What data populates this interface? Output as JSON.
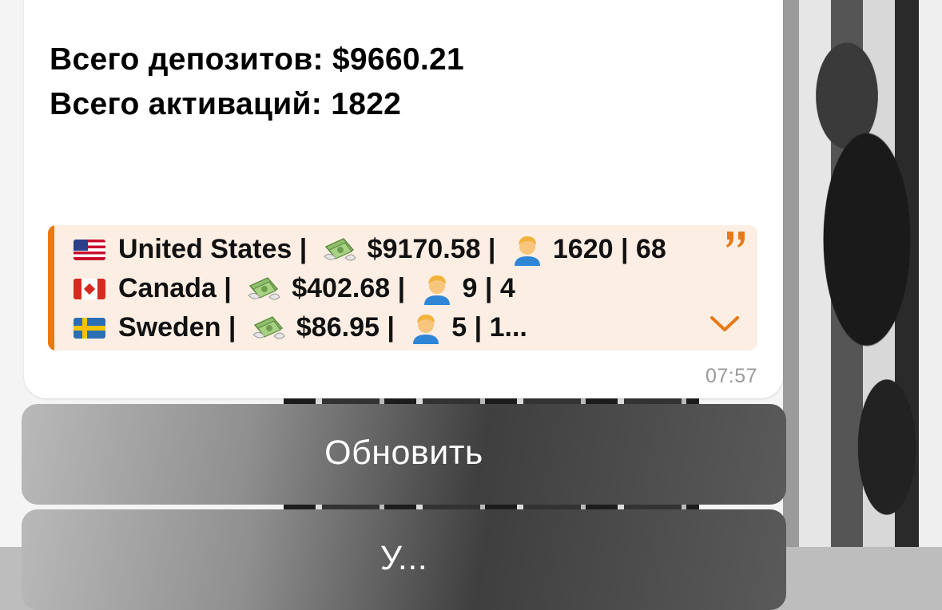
{
  "message": {
    "total_deposits": "Всего депозитов: $9660.21",
    "total_activations": "Всего активаций: 1822",
    "time": "07:57",
    "quote": {
      "rows": [
        {
          "flag": "flag-us",
          "country": "United States",
          "sep1": " | ",
          "amount": "$9170.58",
          "sep2": " | ",
          "stats": "1620 | 68"
        },
        {
          "flag": "flag-ca",
          "country": "Canada",
          "sep1": " | ",
          "amount": "$402.68",
          "sep2": " | ",
          "stats": "9 | 4"
        },
        {
          "flag": "flag-se",
          "country": "Sweden",
          "sep1": " | ",
          "amount": "$86.95",
          "sep2": " | ",
          "stats": "5 | 1..."
        }
      ],
      "accent_color": "#e67a16",
      "background_color": "#fdeee3"
    }
  },
  "keyboard": {
    "buttons": [
      {
        "label": "Обновить"
      },
      {
        "label": "У..."
      }
    ]
  }
}
